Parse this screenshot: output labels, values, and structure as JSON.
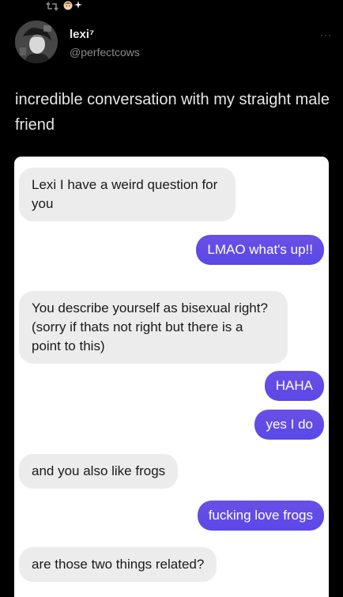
{
  "header": {
    "status_icons": [
      "retweet-icon",
      "face-emoji-icon",
      "sparkles-emoji-icon"
    ],
    "user": {
      "name": "lexi⁷",
      "handle": "@perfectcows"
    },
    "more_glyph": "···"
  },
  "tweet": {
    "text": "incredible conversation with my straight male friend"
  },
  "chat": {
    "messages": [
      {
        "direction": "received",
        "text": "Lexi I have a weird question for you"
      },
      {
        "direction": "sent",
        "text": "LMAO what's up!!"
      },
      {
        "direction": "received",
        "text": "You describe yourself as bisexual right? (sorry if thats not right but there is a point to this)"
      },
      {
        "direction": "sent",
        "text": "HAHA"
      },
      {
        "direction": "sent",
        "text": "yes I do"
      },
      {
        "direction": "received",
        "text": "and you also like frogs"
      },
      {
        "direction": "sent",
        "text": "fucking love frogs"
      },
      {
        "direction": "received",
        "text": "are those two things related?"
      }
    ]
  },
  "colors": {
    "background": "#000000",
    "sent_bubble": "#5e4ae6",
    "received_bubble": "#ececec",
    "chat_background": "#ffffff"
  }
}
